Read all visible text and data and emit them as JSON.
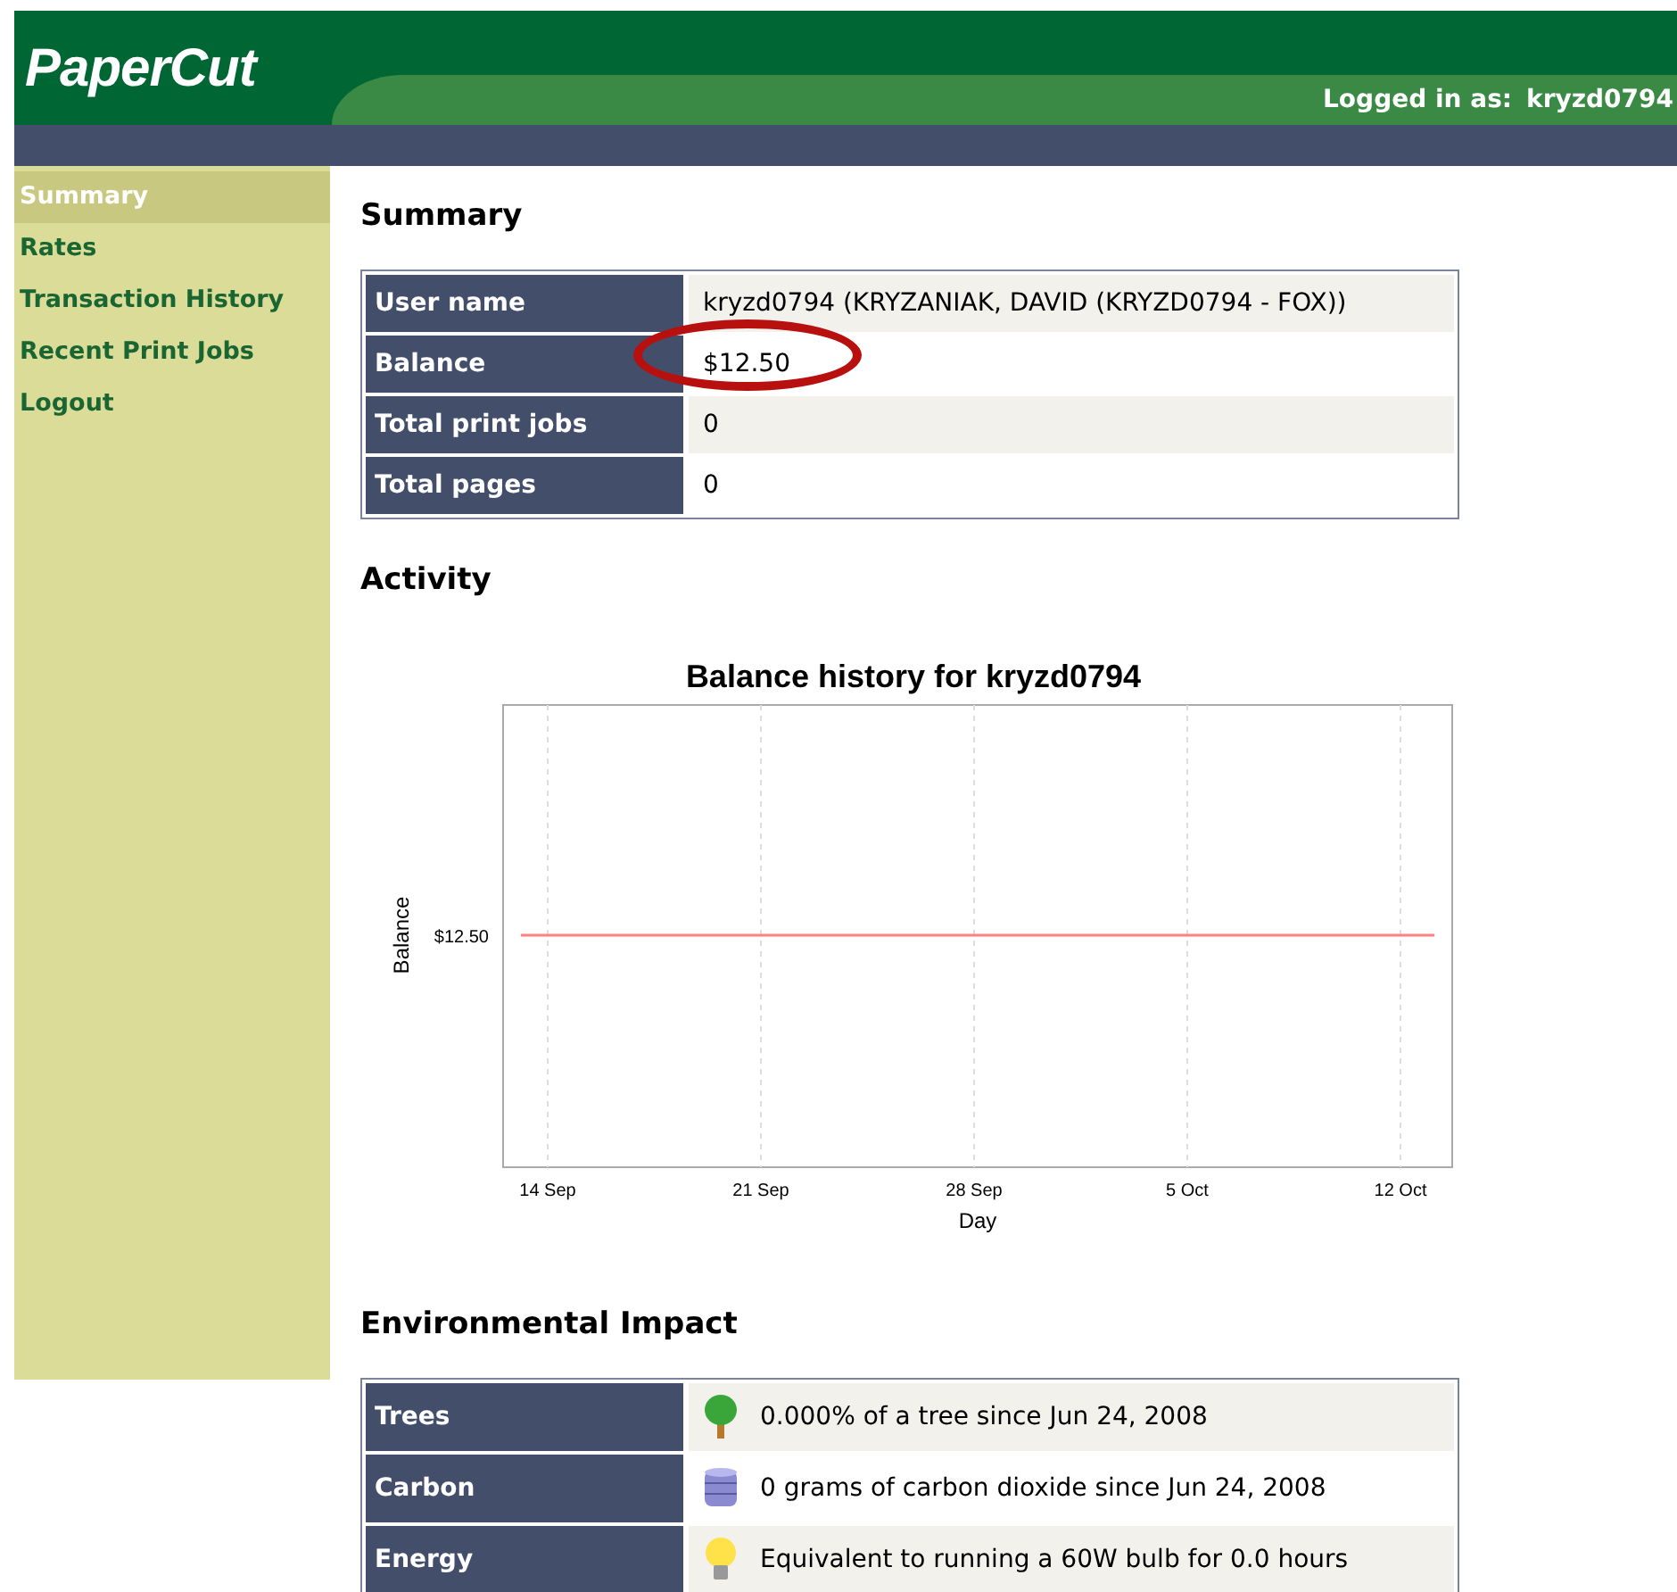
{
  "header": {
    "logo": "PaperCut",
    "logged_in_label": "Logged in as:",
    "username": "kryzd0794"
  },
  "sidebar": {
    "items": [
      {
        "label": "Summary",
        "selected": true
      },
      {
        "label": "Rates",
        "selected": false
      },
      {
        "label": "Transaction History",
        "selected": false
      },
      {
        "label": "Recent Print Jobs",
        "selected": false
      },
      {
        "label": "Logout",
        "selected": false
      }
    ]
  },
  "summary": {
    "title": "Summary",
    "rows": [
      {
        "label": "User name",
        "value": "kryzd0794 (KRYZANIAK, DAVID (KRYZD0794 - FOX))",
        "circled": false
      },
      {
        "label": "Balance",
        "value": "$12.50",
        "circled": true
      },
      {
        "label": "Total print jobs",
        "value": "0",
        "circled": false
      },
      {
        "label": "Total pages",
        "value": "0",
        "circled": false
      }
    ]
  },
  "activity": {
    "title": "Activity",
    "chart": {
      "title": "Balance history for kryzd0794",
      "xlabel": "Day",
      "ylabel": "Balance",
      "x_tick_labels": [
        "14 Sep",
        "21 Sep",
        "28 Sep",
        "5 Oct",
        "12 Oct"
      ],
      "y_tick_label": "$12.50"
    }
  },
  "environment": {
    "title": "Environmental Impact",
    "rows": [
      {
        "label": "Trees",
        "kind": "tree",
        "value": "0.000% of a tree since Jun 24, 2008"
      },
      {
        "label": "Carbon",
        "kind": "barrel",
        "value": "0 grams of carbon dioxide since Jun 24, 2008"
      },
      {
        "label": "Energy",
        "kind": "bulb",
        "value": "Equivalent to running a 60W bulb for 0.0 hours"
      }
    ]
  }
}
